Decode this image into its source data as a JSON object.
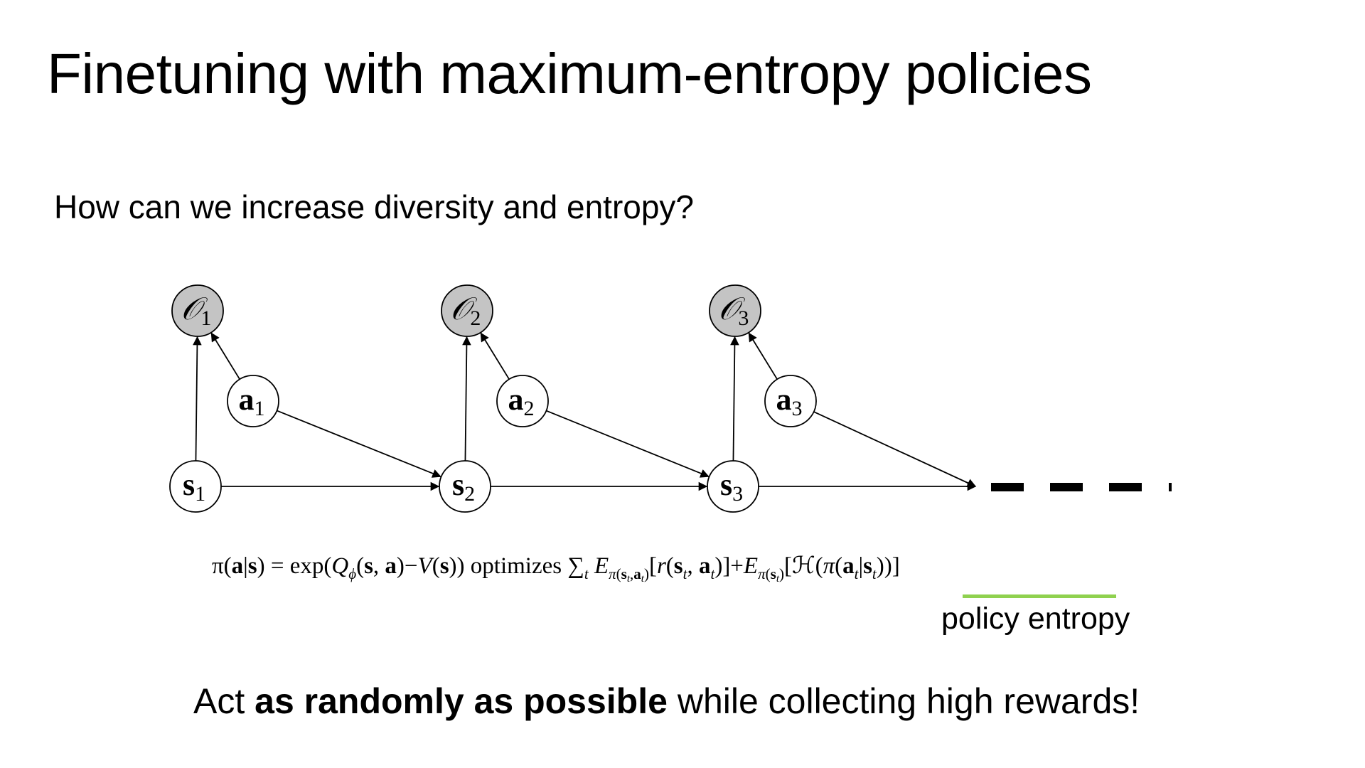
{
  "slide": {
    "title": "Finetuning with maximum-entropy policies",
    "question": "How can we increase diversity and entropy?"
  },
  "diagram": {
    "optimality_nodes": [
      {
        "letter": "𝒪",
        "index": "1"
      },
      {
        "letter": "𝒪",
        "index": "2"
      },
      {
        "letter": "𝒪",
        "index": "3"
      }
    ],
    "action_nodes": [
      {
        "letter": "a",
        "index": "1"
      },
      {
        "letter": "a",
        "index": "2"
      },
      {
        "letter": "a",
        "index": "3"
      }
    ],
    "state_nodes": [
      {
        "letter": "s",
        "index": "1"
      },
      {
        "letter": "s",
        "index": "2"
      },
      {
        "letter": "s",
        "index": "3"
      }
    ],
    "colors": {
      "optimality_fill": "#c4c4c4",
      "node_fill": "#ffffff",
      "stroke": "#000000"
    }
  },
  "formula": {
    "text": "π(a|s) = exp(Qϕ(s, a)−V(s)) optimizes ∑t Eπ(st,at)[r(st, at)]+Eπ(st)[ℋ(π(at|st))]",
    "underline_color": "#8fd14f",
    "underline_label": "policy entropy"
  },
  "bottom": {
    "text_before": "Act ",
    "text_bold": "as randomly as possible",
    "text_after": " while collecting high rewards!"
  }
}
